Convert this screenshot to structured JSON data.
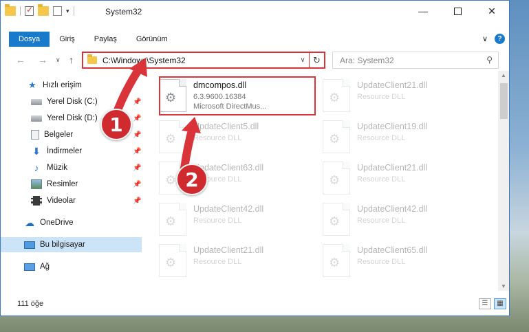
{
  "window": {
    "title": "System32",
    "controls": {
      "minimize": "—",
      "close": "✕"
    }
  },
  "ribbon": {
    "tabs": [
      "Dosya",
      "Giriş",
      "Paylaş",
      "Görünüm"
    ],
    "expand_glyph": "∨",
    "help_glyph": "?"
  },
  "nav": {
    "back": "←",
    "forward": "→",
    "recent": "∨",
    "up": "↑",
    "address": "C:\\Windows\\System32",
    "address_dropdown": "∨",
    "refresh": "↻",
    "search_placeholder": "Ara: System32",
    "search_glyph": "⚲"
  },
  "sidebar": {
    "items": [
      {
        "label": "Hızlı erişim",
        "icon": "star-icon"
      },
      {
        "label": "Yerel Disk (C:)",
        "icon": "drive-icon",
        "pinned": true
      },
      {
        "label": "Yerel Disk (D:)",
        "icon": "drive-icon",
        "pinned": true
      },
      {
        "label": "Belgeler",
        "icon": "documents-icon",
        "pinned": true
      },
      {
        "label": "İndirmeler",
        "icon": "downloads-icon",
        "pinned": true
      },
      {
        "label": "Müzik",
        "icon": "music-icon",
        "pinned": true
      },
      {
        "label": "Resimler",
        "icon": "pictures-icon",
        "pinned": true
      },
      {
        "label": "Videolar",
        "icon": "videos-icon",
        "pinned": true
      },
      {
        "label": "OneDrive",
        "icon": "onedrive-icon"
      },
      {
        "label": "Bu bilgisayar",
        "icon": "this-pc-icon",
        "selected": true
      },
      {
        "label": "Ağ",
        "icon": "network-icon"
      }
    ],
    "pin_glyph": "📌"
  },
  "files": {
    "highlighted": {
      "name": "dmcompos.dll",
      "version": "6.3.9600.16384",
      "description": "Microsoft DirectMus..."
    },
    "faded": [
      {
        "name": "UpdateClient21.dll",
        "type": "Resource DLL"
      },
      {
        "name": "UpdateClient5.dll",
        "type": "Resource DLL"
      },
      {
        "name": "UpdateClient19.dll",
        "type": "Resource DLL"
      },
      {
        "name": "UpdateClient63.dll",
        "type": "Resource DLL"
      },
      {
        "name": "UpdateClient21.dll",
        "type": "Resource DLL"
      },
      {
        "name": "UpdateClient42.dll",
        "type": "Resource DLL"
      },
      {
        "name": "UpdateClient42.dll",
        "type": "Resource DLL"
      },
      {
        "name": "UpdateClient21.dll",
        "type": "Resource DLL"
      },
      {
        "name": "UpdateClient65.dll",
        "type": "Resource DLL"
      }
    ]
  },
  "status": {
    "count": "111 öğe"
  },
  "annotations": {
    "step1": "1",
    "step2": "2",
    "color": "#d9343a"
  }
}
